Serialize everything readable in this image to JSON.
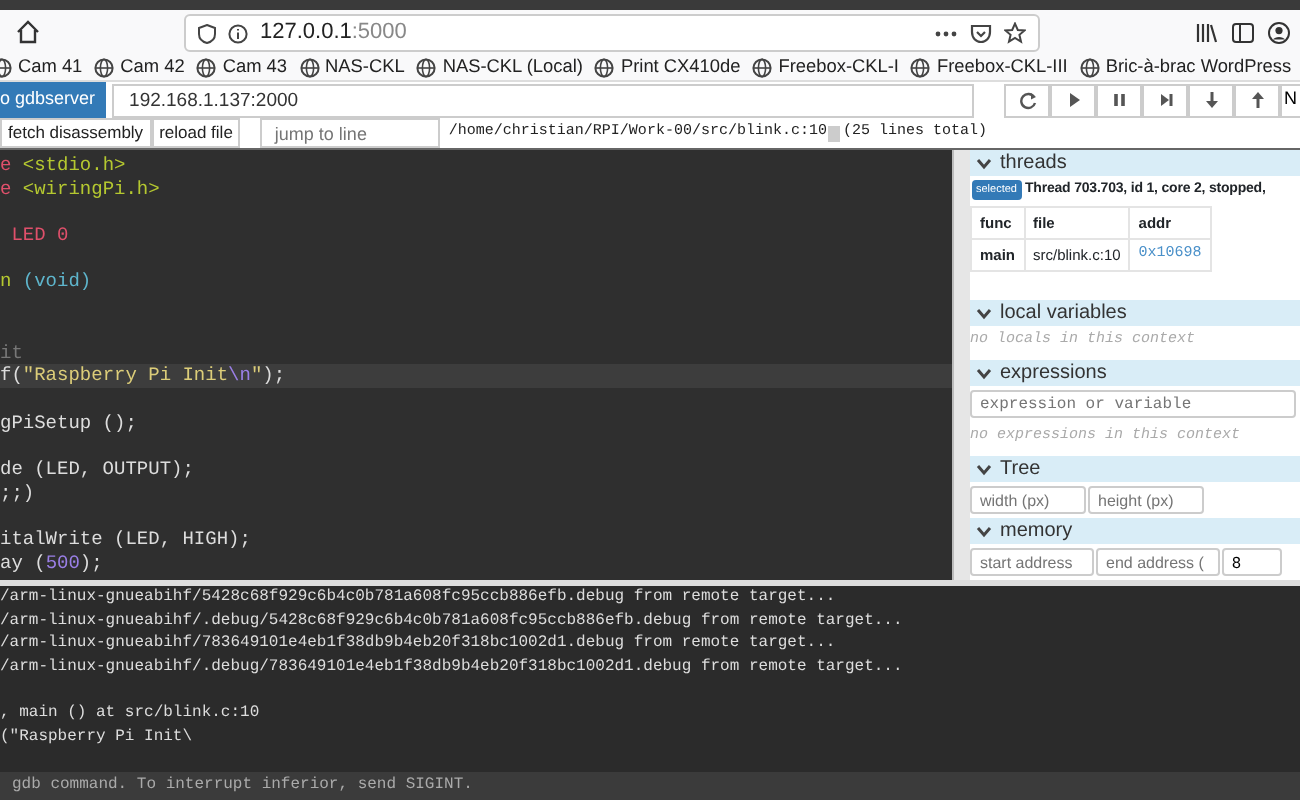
{
  "browser": {
    "url_host": "127.0.0.1",
    "url_port": ":5000"
  },
  "bookmarks": [
    "Cam 41",
    "Cam 42",
    "Cam 43",
    "NAS-CKL",
    "NAS-CKL (Local)",
    "Print CX410de",
    "Freebox-CKL-I",
    "Freebox-CKL-III",
    "Bric-à-brac WordPress"
  ],
  "toolbar": {
    "connect_button": "o gdbserver",
    "address": "192.168.1.137:2000",
    "cut_label": "N"
  },
  "file_bar": {
    "buttons": [
      "fetch disassembly",
      "reload file"
    ],
    "jump_placeholder": "jump to line",
    "path": "/home/christian/RPI/Work-00/src/blink.c:10",
    "line_count": "(25 lines total)"
  },
  "code": {
    "lines": [
      {
        "highlighted": false,
        "tokens": [
          {
            "text": "e ",
            "kind": "preproc"
          },
          {
            "text": "<stdio.h>",
            "kind": "header"
          }
        ]
      },
      {
        "highlighted": false,
        "tokens": [
          {
            "text": "e ",
            "kind": "preproc"
          },
          {
            "text": "<wiringPi.h>",
            "kind": "header"
          }
        ]
      },
      {
        "highlighted": false
      },
      {
        "highlighted": false,
        "tokens": [
          {
            "text": " LED 0",
            "kind": "preproc"
          }
        ]
      },
      {
        "highlighted": false
      },
      {
        "highlighted": false,
        "tokens": [
          {
            "text": "n ",
            "kind": "header"
          },
          {
            "text": "(void)",
            "kind": "type"
          }
        ]
      },
      {
        "highlighted": false
      },
      {
        "highlighted": false
      },
      {
        "highlighted": false,
        "tokens": [
          {
            "text": "it",
            "kind": "comment"
          }
        ]
      },
      {
        "highlighted": true,
        "tokens": [
          {
            "text": "f(",
            "kind": "plain"
          },
          {
            "text": "\"Raspberry Pi Init",
            "kind": "string"
          },
          {
            "text": "\\n",
            "kind": "escape"
          },
          {
            "text": "\"",
            "kind": "string"
          },
          {
            "text": ");",
            "kind": "plain"
          }
        ]
      },
      {
        "highlighted": false
      },
      {
        "highlighted": false,
        "tokens": [
          {
            "text": "gPiSetup ();",
            "kind": "plain"
          }
        ]
      },
      {
        "highlighted": false
      },
      {
        "highlighted": false,
        "tokens": [
          {
            "text": "de (LED, OUTPUT);",
            "kind": "plain"
          }
        ]
      },
      {
        "highlighted": false,
        "tokens": [
          {
            "text": ";;)",
            "kind": "plain"
          }
        ]
      },
      {
        "highlighted": false
      },
      {
        "highlighted": false,
        "tokens": [
          {
            "text": "italWrite (LED, HIGH);",
            "kind": "plain"
          }
        ]
      },
      {
        "highlighted": false,
        "tokens": [
          {
            "text": "ay (",
            "kind": "plain"
          },
          {
            "text": "500",
            "kind": "number"
          },
          {
            "text": ");",
            "kind": "plain"
          }
        ]
      }
    ]
  },
  "side_panel": {
    "threads": {
      "title": "threads",
      "badge": "selected",
      "thread_label": "Thread 703.703, id 1, core 2, stopped,",
      "columns": [
        "func",
        "file",
        "addr"
      ],
      "rows": [
        [
          "main",
          "src/blink.c:10",
          "0x10698"
        ]
      ]
    },
    "locals": {
      "title": "local variables",
      "empty_message": "no locals in this context"
    },
    "expressions": {
      "title": "expressions",
      "placeholder": "expression or variable",
      "empty_message": "no expressions in this context"
    },
    "tree": {
      "title": "Tree",
      "placeholders": [
        "width (px)",
        "height (px)"
      ]
    },
    "memory": {
      "title": "memory",
      "placeholders": [
        "start address",
        "end address ("
      ],
      "value": "8"
    }
  },
  "terminal": {
    "log_lines": [
      "/arm-linux-gnueabihf/5428c68f929c6b4c0b781a608fc95ccb886efb.debug from remote target...",
      "/arm-linux-gnueabihf/.debug/5428c68f929c6b4c0b781a608fc95ccb886efb.debug from remote target...",
      "/arm-linux-gnueabihf/783649101e4eb1f38db9b4eb20f318bc1002d1.debug from remote target...",
      "/arm-linux-gnueabihf/.debug/783649101e4eb1f38db9b4eb20f318bc1002d1.debug from remote target..."
    ],
    "stop_lines": [
      ", main () at src/blink.c:10",
      "(\"Raspberry Pi Init\\"
    ],
    "status": "gdb command. To interrupt inferior, send SIGINT."
  }
}
